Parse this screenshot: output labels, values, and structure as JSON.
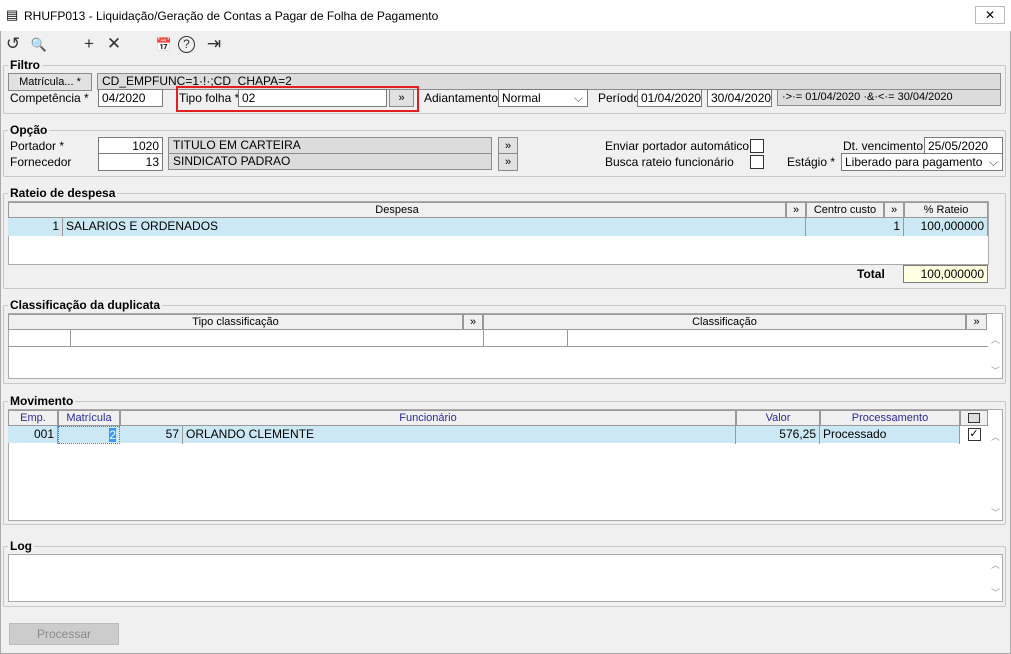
{
  "window": {
    "title": "RHUFP013 - Liquidação/Geração de Contas a Pagar de Folha de Pagamento",
    "close": "✕"
  },
  "toolbar": {
    "undo": "↺",
    "search": "🔍",
    "add": "+",
    "delete": "✕",
    "calendar": "📅",
    "help": "?",
    "exit": "⇥"
  },
  "filtro": {
    "label": "Filtro",
    "matricula_btn": "Matrícula... *",
    "matricula_value": "CD_EMPFUNC=1·!·;CD_CHAPA=2",
    "competencia_label": "Competência *",
    "competencia": "04/2020",
    "tipo_folha_label": "Tipo folha *",
    "tipo_folha": "02",
    "lookup": "»",
    "adiantamento_label": "Adiantamento",
    "adiantamento": "Normal",
    "periodo_label": "Período",
    "periodo_de": "01/04/2020",
    "periodo_ate": "30/04/2020",
    "periodo_expr": "·>·= 01/04/2020 ·&·<·= 30/04/2020"
  },
  "opcao": {
    "label": "Opção",
    "portador_label": "Portador *",
    "portador_code": "1020",
    "portador_name": "TITULO EM CARTEIRA",
    "fornecedor_label": "Fornecedor",
    "fornecedor_code": "13",
    "fornecedor_name": "SINDICATO PADRAO",
    "enviar_label": "Enviar portador automático",
    "busca_label": "Busca rateio funcionário",
    "dt_venc_label": "Dt. vencimento *",
    "dt_venc": "25/05/2020",
    "estagio_label": "Estágio *",
    "estagio": "Liberado para pagamento"
  },
  "rateio": {
    "label": "Rateio de despesa",
    "headers": {
      "despesa": "Despesa",
      "centro": "Centro custo",
      "rateio": "% Rateio"
    },
    "rows": [
      {
        "code": "1",
        "despesa": "SALARIOS E ORDENADOS",
        "centro": "1",
        "rateio": "100,000000"
      }
    ],
    "total_label": "Total",
    "total": "100,000000"
  },
  "classificacao": {
    "label": "Classificação da duplicata",
    "headers": {
      "tipo": "Tipo classificação",
      "classificacao": "Classificação"
    }
  },
  "movimento": {
    "label": "Movimento",
    "headers": {
      "emp": "Emp.",
      "matricula": "Matrícula",
      "funcionario": "Funcionário",
      "valor": "Valor",
      "processamento": "Processamento"
    },
    "rows": [
      {
        "emp": "001",
        "matricula": "2",
        "chapa": "57",
        "funcionario": "ORLANDO CLEMENTE",
        "valor": "576,25",
        "processamento": "Processado",
        "checked": true
      }
    ]
  },
  "log": {
    "label": "Log"
  },
  "processar": "Processar"
}
